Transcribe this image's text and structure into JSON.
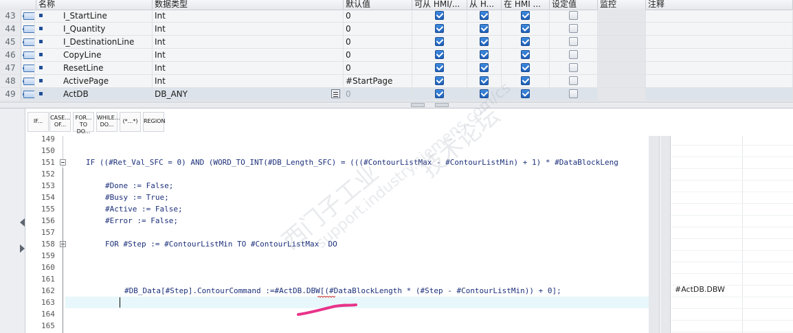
{
  "table": {
    "headers": [
      "名称",
      "数据类型",
      "默认值",
      "可从 HMI/...",
      "从 H...",
      "在 HMI ...",
      "设定值",
      "监控",
      "注释"
    ],
    "rows": [
      {
        "num": "43",
        "name": "I_StartLine",
        "type": "Int",
        "default": "0",
        "hmi_access": true,
        "hmi_visible": true,
        "hmi_write": true,
        "setpoint": false
      },
      {
        "num": "44",
        "name": "I_Quantity",
        "type": "Int",
        "default": "0",
        "hmi_access": true,
        "hmi_visible": true,
        "hmi_write": true,
        "setpoint": false
      },
      {
        "num": "45",
        "name": "I_DestinationLine",
        "type": "Int",
        "default": "0",
        "hmi_access": true,
        "hmi_visible": true,
        "hmi_write": true,
        "setpoint": false
      },
      {
        "num": "46",
        "name": "CopyLine",
        "type": "Int",
        "default": "0",
        "hmi_access": true,
        "hmi_visible": true,
        "hmi_write": true,
        "setpoint": false
      },
      {
        "num": "47",
        "name": "ResetLine",
        "type": "Int",
        "default": "0",
        "hmi_access": true,
        "hmi_visible": true,
        "hmi_write": true,
        "setpoint": false
      },
      {
        "num": "48",
        "name": "ActivePage",
        "type": "Int",
        "default": "#StartPage",
        "hmi_access": true,
        "hmi_visible": true,
        "hmi_write": true,
        "setpoint": false
      },
      {
        "num": "49",
        "name": "ActDB",
        "type": "DB_ANY",
        "default": "0",
        "hmi_access": true,
        "hmi_visible": true,
        "hmi_write": true,
        "setpoint": false,
        "selected": true
      }
    ]
  },
  "toolbar": {
    "buttons": [
      {
        "id": "if",
        "label": "IF..."
      },
      {
        "id": "case",
        "label": "CASE... OF..."
      },
      {
        "id": "for",
        "label": "FOR... TO DO..."
      },
      {
        "id": "while",
        "label": "WHILE... DO..."
      },
      {
        "id": "comment",
        "label": "(*...*)"
      },
      {
        "id": "region",
        "label": "REGION"
      }
    ]
  },
  "code": {
    "lines": [
      {
        "num": "149",
        "text": ""
      },
      {
        "num": "150",
        "text": ""
      },
      {
        "num": "151",
        "text": "IF ((#Ret_Val_SFC = 0) AND (WORD_TO_INT(#DB_Length_SFC) = (((#ContourListMax - #ContourListMin) + 1) * #DataBlockLeng",
        "indent": 0,
        "fold": true
      },
      {
        "num": "152",
        "text": ""
      },
      {
        "num": "153",
        "text": "#Done := False;",
        "indent": 1
      },
      {
        "num": "154",
        "text": "#Busy := True;",
        "indent": 1
      },
      {
        "num": "155",
        "text": "#Active := False;",
        "indent": 1
      },
      {
        "num": "156",
        "text": "#Error := False;",
        "indent": 1
      },
      {
        "num": "157",
        "text": ""
      },
      {
        "num": "158",
        "text": "FOR #Step := #ContourListMin TO #ContourListMax  DO",
        "indent": 1,
        "fold": true
      },
      {
        "num": "159",
        "text": ""
      },
      {
        "num": "160",
        "text": ""
      },
      {
        "num": "161",
        "text": ""
      },
      {
        "num": "162",
        "text": "#DB_Data[#Step].ContourCommand :=#ActDB.DBW[(#DataBlockLength * (#Step - #ContourListMin)) + 0];",
        "indent": 2
      },
      {
        "num": "163",
        "text": ""
      },
      {
        "num": "164",
        "text": ""
      },
      {
        "num": "165",
        "text": ""
      }
    ]
  },
  "monitor": {
    "value_162": "#ActDB.DBW"
  },
  "watermark": {
    "line1": "西门子工业",
    "line2": "support.industry.siemens.com/cs",
    "line3": "技术论坛"
  },
  "colors": {
    "keyword": "#1a2d9e",
    "checkbox_on": "#1f5fb8",
    "annotation": "#e8338a",
    "current_line": "#e8f7fb"
  }
}
